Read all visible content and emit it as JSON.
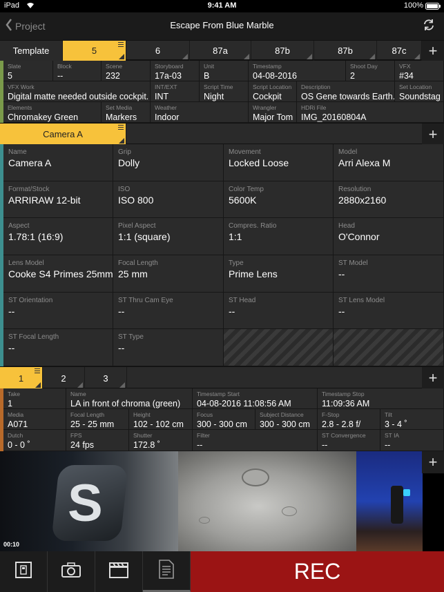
{
  "status": {
    "device": "iPad",
    "time": "9:41 AM",
    "battery": "100%"
  },
  "nav": {
    "back_label": "Project",
    "title": "Escape From Blue Marble"
  },
  "scene_tabs": [
    "Template",
    "5",
    "6",
    "87a",
    "87b",
    "87b",
    "87c"
  ],
  "slate_fields": [
    {
      "label": "Slate",
      "value": "5"
    },
    {
      "label": "Block",
      "value": "--"
    },
    {
      "label": "Scene",
      "value": "232"
    },
    {
      "label": "Storyboard",
      "value": "17a-03"
    },
    {
      "label": "Unit",
      "value": "B"
    },
    {
      "label": "Timestamp",
      "value": "04-08-2016"
    },
    {
      "label": "Shoot Day",
      "value": "2"
    },
    {
      "label": "VFX",
      "value": "#34"
    },
    {
      "label": "VFX Work",
      "value": "Digital matte needed outside cockpit."
    },
    {
      "label": "INT/EXT",
      "value": "INT"
    },
    {
      "label": "Script Time",
      "value": "Night"
    },
    {
      "label": "Script Location",
      "value": "Cockpit"
    },
    {
      "label": "Description",
      "value": "OS Gene towards Earth."
    },
    {
      "label": "Set Location",
      "value": "Soundstag"
    },
    {
      "label": "Elements",
      "value": "Chromakey Green"
    },
    {
      "label": "Set Media",
      "value": "Markers"
    },
    {
      "label": "Weather",
      "value": "Indoor"
    },
    {
      "label": "Wrangler",
      "value": "Major Tom"
    },
    {
      "label": "HDRi File",
      "value": "IMG_20160804A"
    }
  ],
  "camera_tab": "Camera A",
  "camera_fields": [
    {
      "label": "Name",
      "value": "Camera A"
    },
    {
      "label": "Grip",
      "value": "Dolly"
    },
    {
      "label": "Movement",
      "value": "Locked Loose"
    },
    {
      "label": "Model",
      "value": "Arri Alexa M"
    },
    {
      "label": "Format/Stock",
      "value": "ARRIRAW 12-bit"
    },
    {
      "label": "ISO",
      "value": "ISO 800"
    },
    {
      "label": "Color Temp",
      "value": "5600K"
    },
    {
      "label": "Resolution",
      "value": "2880x2160"
    },
    {
      "label": "Aspect",
      "value": "1.78:1 (16:9)"
    },
    {
      "label": "Pixel Aspect",
      "value": "1:1 (square)"
    },
    {
      "label": "Compres. Ratio",
      "value": "1:1"
    },
    {
      "label": "Head",
      "value": "O'Connor"
    },
    {
      "label": "Lens Model",
      "value": "Cooke S4 Primes 25mm"
    },
    {
      "label": "Focal Length",
      "value": "25 mm"
    },
    {
      "label": "Type",
      "value": "Prime Lens"
    },
    {
      "label": "ST Model",
      "value": "--"
    },
    {
      "label": "ST Orientation",
      "value": "--"
    },
    {
      "label": "ST Thru Cam Eye",
      "value": "--"
    },
    {
      "label": "ST Head",
      "value": "--"
    },
    {
      "label": "ST Lens Model",
      "value": "--"
    },
    {
      "label": "ST Focal Length",
      "value": "--"
    },
    {
      "label": "ST Type",
      "value": "--"
    }
  ],
  "take_tabs": [
    "1",
    "2",
    "3"
  ],
  "take_fields": [
    {
      "label": "Take",
      "value": "1"
    },
    {
      "label": "Name",
      "value": "LA in front of chroma (green)"
    },
    {
      "label": "Timestamp Start",
      "value": "04-08-2016 11:08:56 AM"
    },
    {
      "label": "Timestamp Stop",
      "value": "11:09:36 AM"
    },
    {
      "label": "Media",
      "value": "A071"
    },
    {
      "label": "Focal Length",
      "value": "25 - 25 mm"
    },
    {
      "label": "Height",
      "value": "102 - 102 cm"
    },
    {
      "label": "Focus",
      "value": "300 - 300 cm"
    },
    {
      "label": "Subject Distance",
      "value": "300 - 300 cm"
    },
    {
      "label": "F-Stop",
      "value": "2.8 - 2.8 f/"
    },
    {
      "label": "Tilt",
      "value": "3 - 4 ˚"
    },
    {
      "label": "Dutch",
      "value": "0 - 0 ˚"
    },
    {
      "label": "FPS",
      "value": "24 fps"
    },
    {
      "label": "Shutter",
      "value": "172.8 ˚"
    },
    {
      "label": "Filter",
      "value": "--"
    },
    {
      "label": "ST Convergence",
      "value": "--"
    },
    {
      "label": "ST IA",
      "value": "--"
    }
  ],
  "media": {
    "duration": "00:10"
  },
  "toolbar": {
    "rec_label": "REC"
  }
}
